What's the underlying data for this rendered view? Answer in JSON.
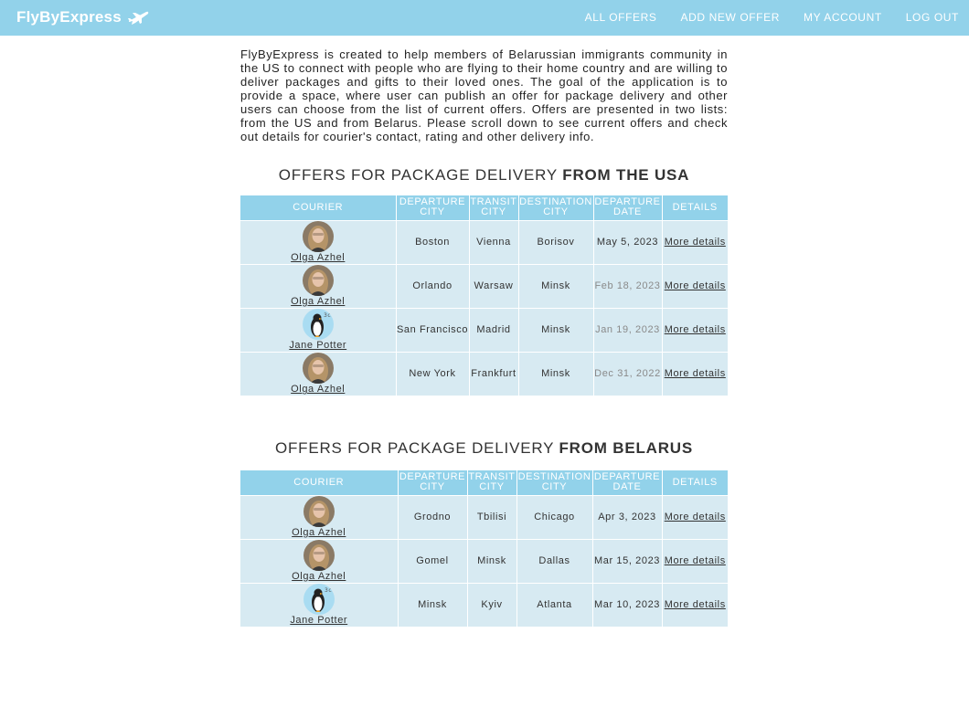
{
  "navbar": {
    "brand": "FlyByExpress",
    "links": [
      "ALL OFFERS",
      "ADD NEW OFFER",
      "MY ACCOUNT",
      "LOG OUT"
    ]
  },
  "intro": "FlyByExpress is created to help members of Belarussian immigrants community in the US to connect with people who are flying to their home country and are willing to deliver packages and gifts to their loved ones. The goal of the application is to provide a space, where user can publish an offer for package delivery and other users can choose from the list of current offers. Offers are presented in two lists: from the US and from Belarus. Please scroll down to see current offers and check out details for courier's contact, rating and other delivery info.",
  "headers": [
    "COURIER",
    "DEPARTURE CITY",
    "TRANSIT CITY",
    "DESTINATION CITY",
    "DEPARTURE DATE",
    "DETAILS"
  ],
  "sections": [
    {
      "title_prefix": "OFFERS FOR PACKAGE DELIVERY ",
      "title_bold": "FROM THE USA",
      "rows": [
        {
          "courier": "Olga Azhel",
          "avatar": "photo-avatar",
          "departure": "Boston",
          "transit": "Vienna",
          "destination": "Borisov",
          "date": "May 5, 2023",
          "past": false,
          "details": "More details"
        },
        {
          "courier": "Olga Azhel",
          "avatar": "photo-avatar",
          "departure": "Orlando",
          "transit": "Warsaw",
          "destination": "Minsk",
          "date": "Feb 18, 2023",
          "past": true,
          "details": "More details"
        },
        {
          "courier": "Jane Potter",
          "avatar": "penguin-avatar",
          "departure": "San Francisco",
          "transit": "Madrid",
          "destination": "Minsk",
          "date": "Jan 19, 2023",
          "past": true,
          "details": "More details"
        },
        {
          "courier": "Olga Azhel",
          "avatar": "photo-avatar",
          "departure": "New York",
          "transit": "Frankfurt",
          "destination": "Minsk",
          "date": "Dec 31, 2022",
          "past": true,
          "details": "More details"
        }
      ]
    },
    {
      "title_prefix": "OFFERS FOR PACKAGE DELIVERY ",
      "title_bold": "FROM BELARUS",
      "rows": [
        {
          "courier": "Olga Azhel",
          "avatar": "photo-avatar",
          "departure": "Grodno",
          "transit": "Tbilisi",
          "destination": "Chicago",
          "date": "Apr 3, 2023",
          "past": false,
          "details": "More details"
        },
        {
          "courier": "Olga Azhel",
          "avatar": "photo-avatar",
          "departure": "Gomel",
          "transit": "Minsk",
          "destination": "Dallas",
          "date": "Mar 15, 2023",
          "past": false,
          "details": "More details"
        },
        {
          "courier": "Jane Potter",
          "avatar": "penguin-avatar",
          "departure": "Minsk",
          "transit": "Kyiv",
          "destination": "Atlanta",
          "date": "Mar 10, 2023",
          "past": false,
          "details": "More details"
        }
      ]
    }
  ],
  "colors": {
    "navbar": "#92d2ea",
    "header_row": "#92d2ea",
    "cell_bg": "#d7eaf2",
    "past_date": "#8a8a8a"
  }
}
